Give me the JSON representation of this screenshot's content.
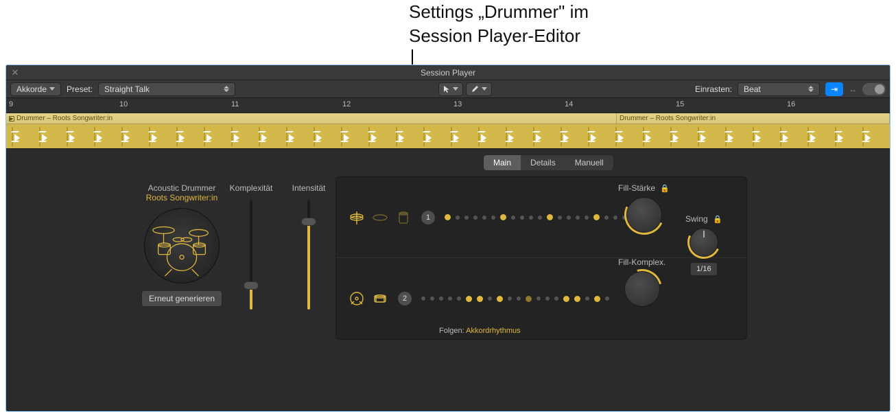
{
  "annotation": {
    "line1": "Settings „Drummer\" im",
    "line2": "Session Player-Editor"
  },
  "header": {
    "title": "Session Player"
  },
  "toolbar": {
    "chords_label": "Akkorde",
    "preset_label": "Preset:",
    "preset_value": "Straight Talk",
    "snap_label": "Einrasten:",
    "snap_value": "Beat"
  },
  "ruler": {
    "ticks": [
      "9",
      "10",
      "11",
      "12",
      "13",
      "14",
      "15",
      "16"
    ]
  },
  "region": {
    "name1": "Drummer – Roots Songwriter:in",
    "name2": "Drummer – Roots Songwriter:in"
  },
  "tabs": {
    "main": "Main",
    "details": "Details",
    "manual": "Manuell"
  },
  "drummer": {
    "category": "Acoustic Drummer",
    "style": "Roots Songwriter:in",
    "regenerate": "Erneut generieren"
  },
  "sliders": {
    "complexity_label": "Komplexität",
    "complexity_value": 0.22,
    "intensity_label": "Intensität",
    "intensity_value": 0.8
  },
  "pattern": {
    "row1_badge": "1",
    "row2_badge": "2",
    "follow_label": "Folgen:",
    "follow_value": "Akkordrhythmus"
  },
  "knobs": {
    "fill_amount_label": "Fill-Stärke",
    "fill_complex_label": "Fill-Komplex.",
    "swing_label": "Swing",
    "swing_value": "1/16"
  }
}
